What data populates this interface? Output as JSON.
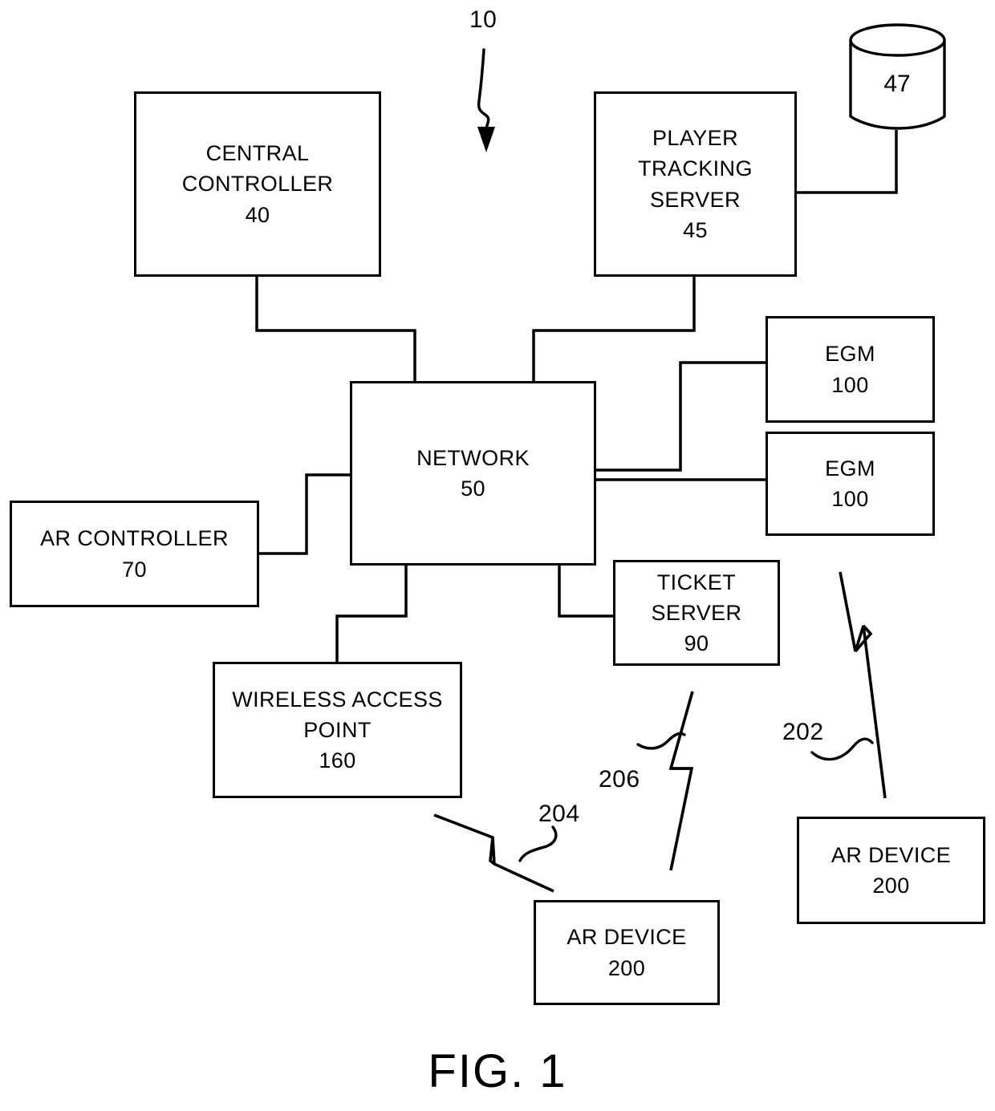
{
  "figure": {
    "caption": "FIG. 1",
    "system_ref": "10"
  },
  "nodes": [
    {
      "id": "central-controller",
      "label": "CENTRAL\nCONTROLLER",
      "ref": "40"
    },
    {
      "id": "player-tracking-server",
      "label": "PLAYER\nTRACKING\nSERVER",
      "ref": "45"
    },
    {
      "id": "player-database",
      "label": "",
      "ref": "47"
    },
    {
      "id": "network",
      "label": "NETWORK",
      "ref": "50"
    },
    {
      "id": "egm-1",
      "label": "EGM",
      "ref": "100"
    },
    {
      "id": "egm-2",
      "label": "EGM",
      "ref": "100"
    },
    {
      "id": "ar-controller",
      "label": "AR CONTROLLER",
      "ref": "70"
    },
    {
      "id": "ticket-server",
      "label": "TICKET\nSERVER",
      "ref": "90"
    },
    {
      "id": "wireless-access-point",
      "label": "WIRELESS ACCESS\nPOINT",
      "ref": "160"
    },
    {
      "id": "ar-device-bottom",
      "label": "AR DEVICE",
      "ref": "200"
    },
    {
      "id": "ar-device-right",
      "label": "AR DEVICE",
      "ref": "200"
    }
  ],
  "wireless_links": [
    {
      "id": "link-202",
      "ref": "202"
    },
    {
      "id": "link-204",
      "ref": "204"
    },
    {
      "id": "link-206",
      "ref": "206"
    }
  ],
  "colors": {
    "line": "#000000",
    "background": "#ffffff"
  }
}
